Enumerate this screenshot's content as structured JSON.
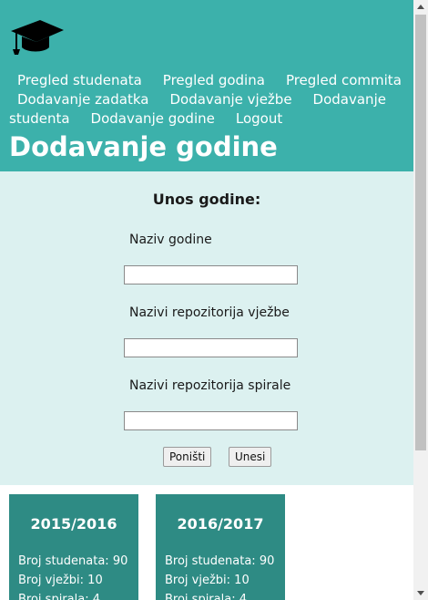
{
  "nav": {
    "items": [
      "Pregled studenata",
      "Pregled godina",
      "Pregled commita",
      "Dodavanje zadatka",
      "Dodavanje vježbe",
      "Dodavanje",
      "studenta",
      "Dodavanje godine",
      "Logout"
    ]
  },
  "page_title": "Dodavanje godine",
  "form": {
    "heading": "Unos godine:",
    "year_name_label": "Naziv godine",
    "year_name_value": "",
    "exercise_repos_label": "Nazivi repozitorija vježbe",
    "exercise_repos_value": "",
    "spiral_repos_label": "Nazivi repozitorija spirale",
    "spiral_repos_value": "",
    "reset_button": "Poništi",
    "submit_button": "Unesi"
  },
  "years": [
    {
      "title": "2015/2016",
      "students": "Broj studenata: 90",
      "exercises": "Broj vježbi: 10",
      "spirals": "Broj spirala: 4"
    },
    {
      "title": "2016/2017",
      "students": "Broj studenata: 90",
      "exercises": "Broj vježbi: 10",
      "spirals": "Broj spirala: 4"
    }
  ],
  "colors": {
    "header": "#3cb1ab",
    "form_bg": "#dcf1f0",
    "card": "#2e8b84"
  },
  "icons": {
    "logo": "graduation-cap-icon"
  }
}
